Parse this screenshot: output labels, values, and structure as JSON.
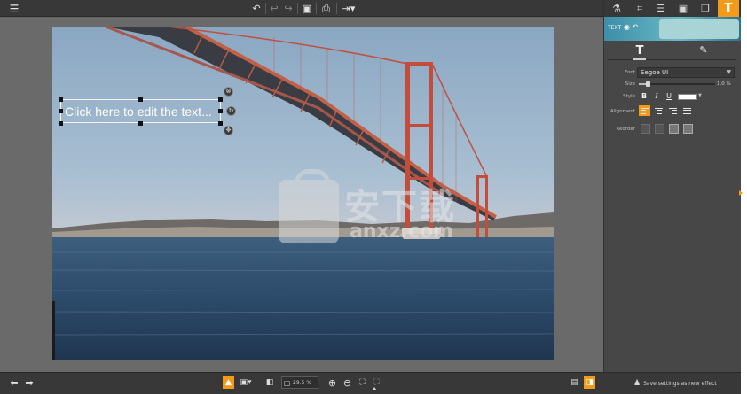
{
  "toolbar": {
    "menu_icon": "hamburger-menu-icon",
    "undo_icon": "undo-icon",
    "redo_icon": "redo-icon",
    "save_icon": "save-icon",
    "print_icon": "print-icon",
    "export_icon": "export-icon"
  },
  "canvas": {
    "text_placeholder": "Click here to edit the text..."
  },
  "watermark": {
    "cn": "安下载",
    "url": "anxz.com"
  },
  "panel": {
    "tabs": [
      {
        "icon": "flask-icon",
        "glyph": "⚗"
      },
      {
        "icon": "crop-icon",
        "glyph": "⌗"
      },
      {
        "icon": "adjust-sliders-icon",
        "glyph": "☰"
      },
      {
        "icon": "frame-icon",
        "glyph": "▣"
      },
      {
        "icon": "layers-icon",
        "glyph": "❐"
      },
      {
        "icon": "text-tool-icon",
        "glyph": "T"
      }
    ],
    "banner_label": "TEXT",
    "sub_tools": [
      {
        "icon": "text-icon",
        "glyph": "T"
      },
      {
        "icon": "edit-icon",
        "glyph": "✎"
      }
    ],
    "font_label": "Font",
    "font_value": "Segoe UI",
    "size_label": "Size",
    "size_value": "1.0 %",
    "size_fraction": 0.12,
    "style_label": "Style",
    "style_bold": "B",
    "style_italic": "I",
    "style_underline": "U",
    "text_color": "#ffffff",
    "alignment_label": "Alignment",
    "reorder_label": "Reorder",
    "accent": "#f39a18"
  },
  "bottombar": {
    "zoom_value": "29.5 %",
    "save_settings": "Save settings as new effect"
  }
}
